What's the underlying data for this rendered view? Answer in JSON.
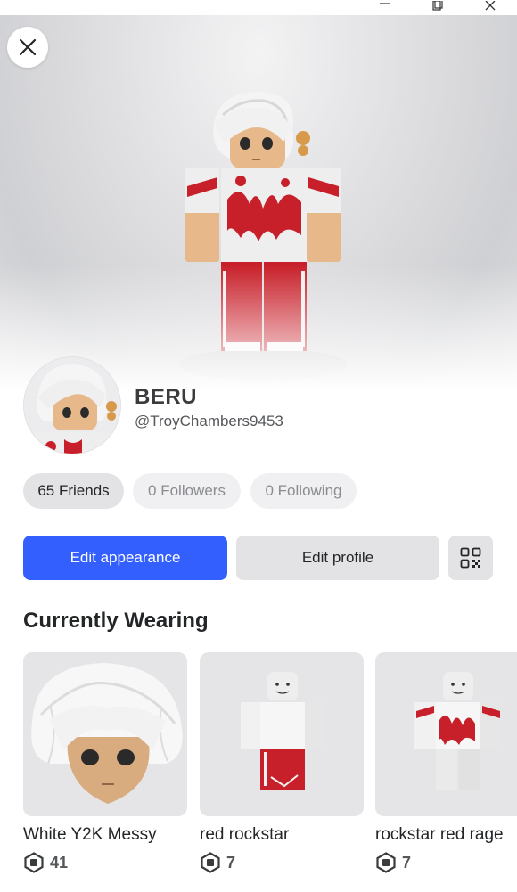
{
  "window": {
    "controls": [
      "minimize",
      "restore",
      "close"
    ]
  },
  "profile": {
    "display_name": "BERU",
    "username": "@TroyChambers9453"
  },
  "stats": {
    "friends": "65 Friends",
    "followers": "0 Followers",
    "following": "0 Following"
  },
  "actions": {
    "edit_appearance": "Edit appearance",
    "edit_profile": "Edit profile"
  },
  "wearing": {
    "title": "Currently Wearing",
    "items": [
      {
        "name": "White Y2K Messy",
        "price": "41"
      },
      {
        "name": "red rockstar",
        "price": "7"
      },
      {
        "name": "rockstar red rage",
        "price": "7"
      }
    ]
  },
  "colors": {
    "accent": "#335fff",
    "shirt_red": "#c8202a",
    "skin": "#e7b98a"
  },
  "icons": {
    "close": "close-icon",
    "qr": "qr-code-icon",
    "currency": "robux-icon"
  }
}
